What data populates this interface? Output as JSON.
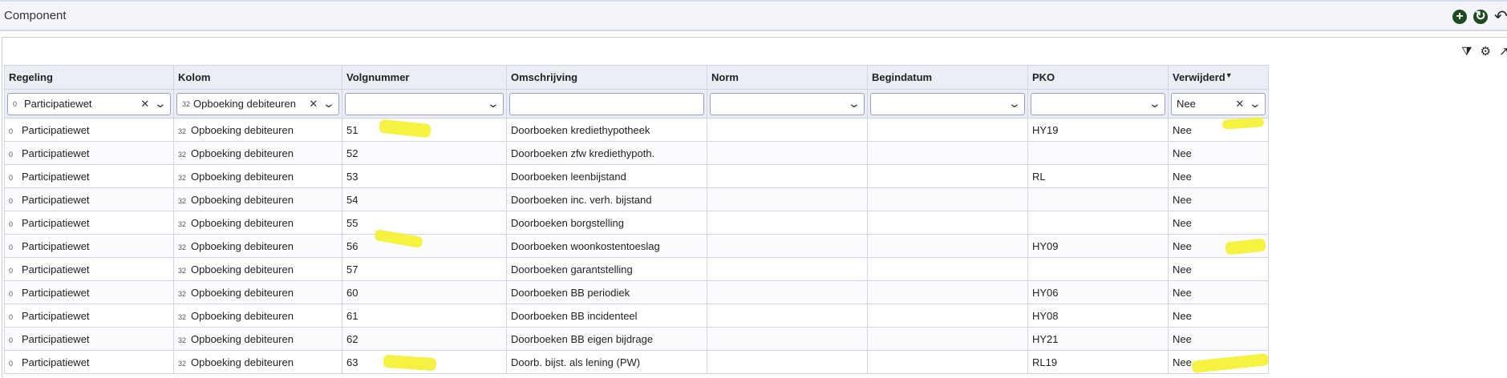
{
  "window": {
    "title": "Component"
  },
  "header_actions": {
    "add_icon": "plus-circle-icon",
    "refresh_icon": "refresh-circle-icon",
    "undo_icon": "undo-icon"
  },
  "panel_tools": {
    "filter_clear_icon": "filter-clear-icon",
    "settings_icon": "gear-icon",
    "export_icon": "export-icon"
  },
  "columns": [
    "Regeling",
    "Kolom",
    "Volgnummer",
    "Omschrijving",
    "Norm",
    "Begindatum",
    "PKO",
    "Verwijderd"
  ],
  "filters": {
    "regeling": {
      "code": "0",
      "value": "Participatiewet"
    },
    "kolom": {
      "code": "32",
      "value": "Opboeking debiteuren"
    },
    "volgnummer": {
      "value": ""
    },
    "omschrijving": {
      "value": ""
    },
    "norm": {
      "value": ""
    },
    "begindatum": {
      "value": ""
    },
    "pko": {
      "value": ""
    },
    "verwijderd": {
      "value": "Nee"
    }
  },
  "rows": [
    {
      "regeling_code": "0",
      "regeling": "Participatiewet",
      "kolom_code": "32",
      "kolom": "Opboeking debiteuren",
      "volgnummer": "51",
      "omschrijving": "Doorboeken krediethypotheek",
      "norm": "",
      "begindatum": "",
      "pko": "HY19",
      "verwijderd": "Nee"
    },
    {
      "regeling_code": "0",
      "regeling": "Participatiewet",
      "kolom_code": "32",
      "kolom": "Opboeking debiteuren",
      "volgnummer": "52",
      "omschrijving": "Doorboeken zfw krediethypoth.",
      "norm": "",
      "begindatum": "",
      "pko": "",
      "verwijderd": "Nee"
    },
    {
      "regeling_code": "0",
      "regeling": "Participatiewet",
      "kolom_code": "32",
      "kolom": "Opboeking debiteuren",
      "volgnummer": "53",
      "omschrijving": "Doorboeken leenbijstand",
      "norm": "",
      "begindatum": "",
      "pko": "RL",
      "verwijderd": "Nee"
    },
    {
      "regeling_code": "0",
      "regeling": "Participatiewet",
      "kolom_code": "32",
      "kolom": "Opboeking debiteuren",
      "volgnummer": "54",
      "omschrijving": "Doorboeken inc. verh. bijstand",
      "norm": "",
      "begindatum": "",
      "pko": "",
      "verwijderd": "Nee"
    },
    {
      "regeling_code": "0",
      "regeling": "Participatiewet",
      "kolom_code": "32",
      "kolom": "Opboeking debiteuren",
      "volgnummer": "55",
      "omschrijving": "Doorboeken borgstelling",
      "norm": "",
      "begindatum": "",
      "pko": "",
      "verwijderd": "Nee"
    },
    {
      "regeling_code": "0",
      "regeling": "Participatiewet",
      "kolom_code": "32",
      "kolom": "Opboeking debiteuren",
      "volgnummer": "56",
      "omschrijving": "Doorboeken woonkostentoeslag",
      "norm": "",
      "begindatum": "",
      "pko": "HY09",
      "verwijderd": "Nee"
    },
    {
      "regeling_code": "0",
      "regeling": "Participatiewet",
      "kolom_code": "32",
      "kolom": "Opboeking debiteuren",
      "volgnummer": "57",
      "omschrijving": "Doorboeken garantstelling",
      "norm": "",
      "begindatum": "",
      "pko": "",
      "verwijderd": "Nee"
    },
    {
      "regeling_code": "0",
      "regeling": "Participatiewet",
      "kolom_code": "32",
      "kolom": "Opboeking debiteuren",
      "volgnummer": "60",
      "omschrijving": "Doorboeken BB periodiek",
      "norm": "",
      "begindatum": "",
      "pko": "HY06",
      "verwijderd": "Nee"
    },
    {
      "regeling_code": "0",
      "regeling": "Participatiewet",
      "kolom_code": "32",
      "kolom": "Opboeking debiteuren",
      "volgnummer": "61",
      "omschrijving": "Doorboeken BB incidenteel",
      "norm": "",
      "begindatum": "",
      "pko": "HY08",
      "verwijderd": "Nee"
    },
    {
      "regeling_code": "0",
      "regeling": "Participatiewet",
      "kolom_code": "32",
      "kolom": "Opboeking debiteuren",
      "volgnummer": "62",
      "omschrijving": "Doorboeken BB eigen bijdrage",
      "norm": "",
      "begindatum": "",
      "pko": "HY21",
      "verwijderd": "Nee"
    },
    {
      "regeling_code": "0",
      "regeling": "Participatiewet",
      "kolom_code": "32",
      "kolom": "Opboeking debiteuren",
      "volgnummer": "63",
      "omschrijving": "Doorb. bijst. als lening (PW)",
      "norm": "",
      "begindatum": "",
      "pko": "RL19",
      "verwijderd": "Nee"
    }
  ]
}
